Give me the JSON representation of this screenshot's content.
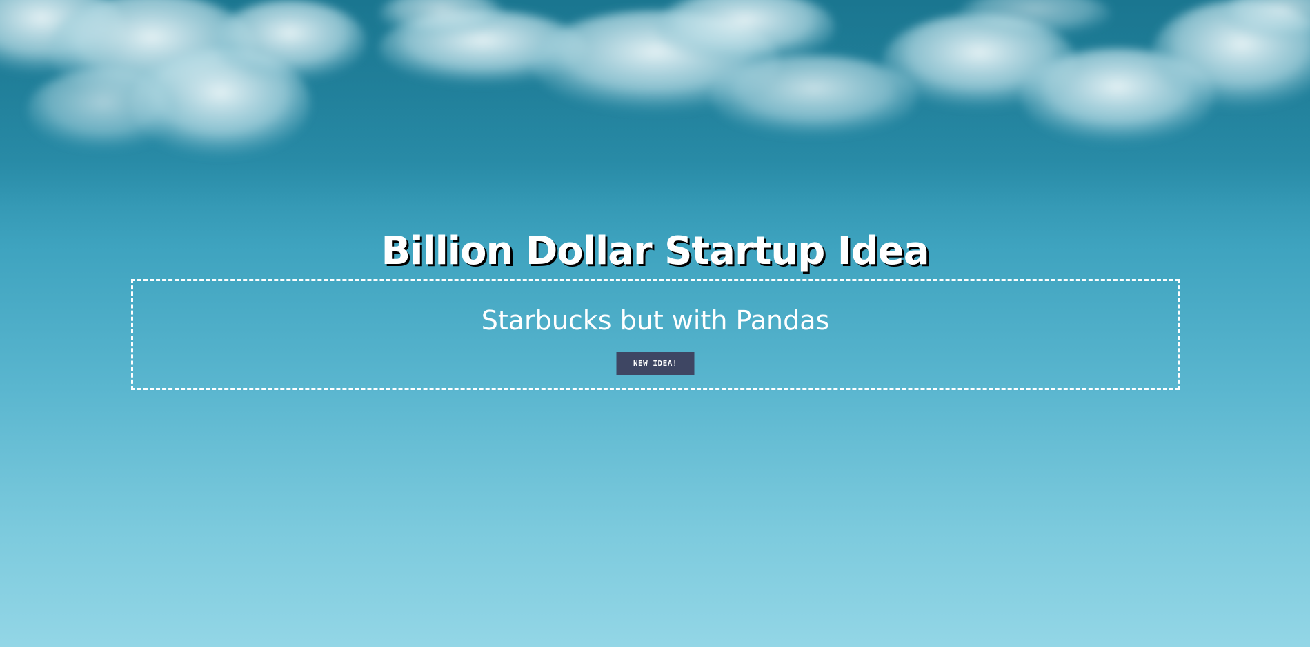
{
  "page": {
    "title": "Billion Dollar Startup Idea"
  },
  "idea": {
    "text": "Starbucks but with Pandas",
    "button_label": "NEW IDEA!"
  },
  "colors": {
    "sky_top": "#1f7f99",
    "sky_bottom": "#93d6e6",
    "button_bg": "#3e4663",
    "text": "#ffffff"
  },
  "background": {
    "image": "cloudy-sky"
  }
}
